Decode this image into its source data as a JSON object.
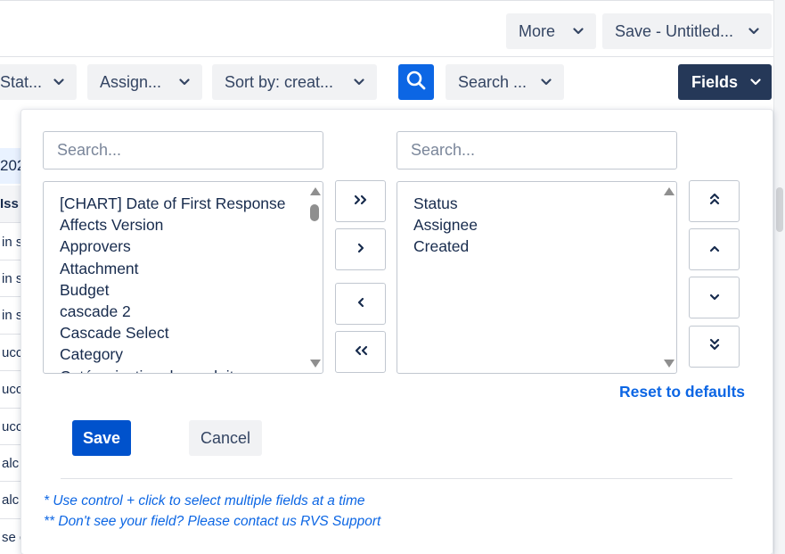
{
  "toolbar_top": {
    "more_label": "More",
    "save_label": "Save - Untitled..."
  },
  "filters": {
    "status_label": "Stat...",
    "assignee_label": "Assign...",
    "sort_label": "Sort by: creat...",
    "search_label": "Search ...",
    "fields_label": "Fields"
  },
  "background_table": {
    "header_fragment": "202",
    "column_fragment": "Iss",
    "rows": [
      "in s",
      "in s",
      "in s",
      "ucc",
      "ucc",
      "ucc",
      "alc",
      "alc",
      "se c"
    ]
  },
  "panel": {
    "available_search_placeholder": "Search...",
    "selected_search_placeholder": "Search...",
    "available_fields": [
      "[CHART] Date of First Response",
      "Affects Version",
      "Approvers",
      "Attachment",
      "Budget",
      "cascade 2",
      "Cascade Select",
      "Category",
      "Catégorisation du produit"
    ],
    "selected_fields": [
      "Status",
      "Assignee",
      "Created"
    ],
    "move_buttons": {
      "add_all": "»",
      "add": "›",
      "remove": "‹",
      "remove_all": "«"
    },
    "reset_label": "Reset to defaults",
    "save_label": "Save",
    "cancel_label": "Cancel",
    "hint_1": "* Use control + click to select multiple fields at a time",
    "hint_2": "** Don't see your field? Please contact us  RVS Support"
  },
  "colors": {
    "primary": "#0052cc",
    "link": "#0c66e4",
    "dark_button": "#253858",
    "neutral_button": "#f1f2f4"
  },
  "icons": [
    "chevron-down-icon",
    "search-icon",
    "double-chevron-up-icon",
    "chevron-up-icon",
    "chevron-down-icon",
    "double-chevron-down-icon"
  ]
}
